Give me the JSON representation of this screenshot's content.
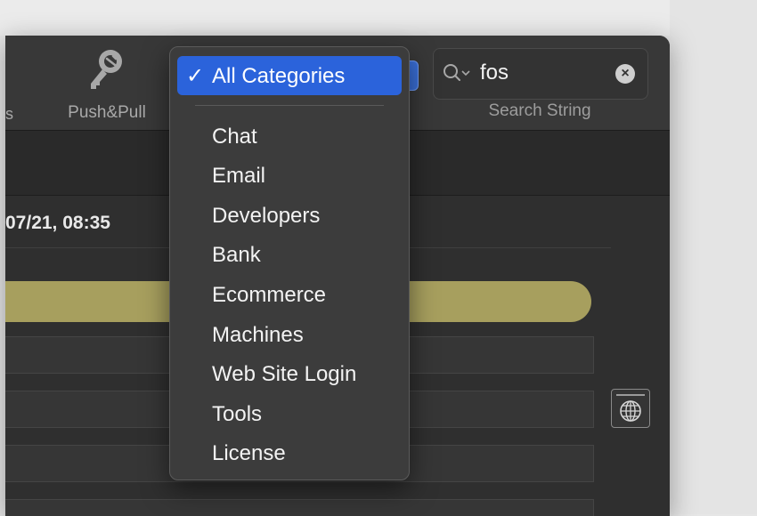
{
  "toolbar": {
    "cut_label": "s",
    "push_pull_label": "Push&Pull",
    "search": {
      "value": "fos",
      "label": "Search String"
    }
  },
  "content": {
    "date_text": "07/21, 08:35"
  },
  "category_menu": {
    "selected_check": "✓",
    "selected": "All Categories",
    "items": [
      "Chat",
      "Email",
      "Developers",
      "Bank",
      "Ecommerce",
      "Machines",
      "Web Site Login",
      "Tools",
      "License"
    ]
  },
  "colors": {
    "accent": "#2b63db",
    "highlight_bar": "#a79f5e"
  },
  "icons": {
    "push_pull": "key-push-pull-icon",
    "search": "search-icon",
    "clear": "clear-icon",
    "web": "globe-window-icon"
  }
}
